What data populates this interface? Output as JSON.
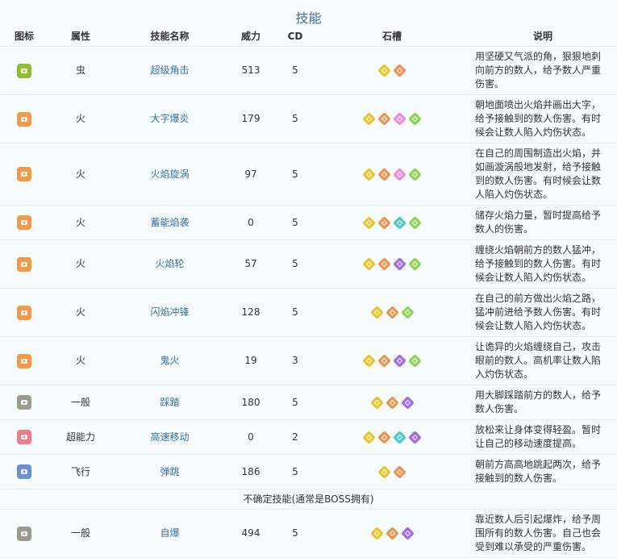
{
  "title": "技能",
  "headers": [
    "图标",
    "属性",
    "技能名称",
    "威力",
    "CD",
    "石槽",
    "说明"
  ],
  "colors": {
    "bug": "#8fbf2f",
    "fire": "#f39a48",
    "normal": "#9a9a8e",
    "psychic": "#ee7b8e",
    "flying": "#6d8fd6",
    "stone_yellow": "#e8c62f",
    "stone_orange": "#ec9552",
    "stone_pink": "#ec8ed6",
    "stone_green": "#8fd45a",
    "stone_teal": "#4fc9c9",
    "stone_purple": "#a36ee0"
  },
  "skills": [
    {
      "icon": "bug-skill-icon",
      "type": "虫",
      "name": "超级角击",
      "power": "513",
      "cd": "5",
      "stones": [
        "yellow",
        "orange"
      ],
      "desc": "用坚硬又气派的角，狠狠地刺向前方的数人，给予数人严重伤害。"
    },
    {
      "icon": "fire-skill-icon",
      "type": "火",
      "name": "大字爆炎",
      "power": "179",
      "cd": "5",
      "stones": [
        "yellow",
        "orange",
        "pink",
        "green"
      ],
      "desc": "朝地面喷出火焰并画出大字，给予接触到的数人伤害。有时候会让数人陷入灼伤状态。"
    },
    {
      "icon": "fire-skill-icon",
      "type": "火",
      "name": "火焰旋涡",
      "power": "97",
      "cd": "5",
      "stones": [
        "yellow",
        "orange",
        "pink",
        "green"
      ],
      "desc": "在自己的周围制造出火焰，并如画漩涡般地发射，给予接触到的数人伤害。有时候会让数人陷入灼伤状态。"
    },
    {
      "icon": "fire-skill-icon",
      "type": "火",
      "name": "蓄能焰袭",
      "power": "0",
      "cd": "5",
      "stones": [
        "yellow",
        "orange",
        "teal",
        "green"
      ],
      "desc": "储存火焰力量，暂时提高给予数人的伤害。"
    },
    {
      "icon": "fire-skill-icon",
      "type": "火",
      "name": "火焰轮",
      "power": "57",
      "cd": "5",
      "stones": [
        "yellow",
        "orange",
        "purple",
        "green"
      ],
      "desc": "缠绕火焰朝前方的数人猛冲，给予接触到的数人伤害。有时候会让数人陷入灼伤状态。"
    },
    {
      "icon": "fire-skill-icon",
      "type": "火",
      "name": "闪焰冲锋",
      "power": "128",
      "cd": "5",
      "stones": [
        "yellow",
        "orange",
        "green"
      ],
      "desc": "在自己的前方做出火焰之路，猛冲前进给予数人伤害。有时候会让数人陷入灼伤状态。"
    },
    {
      "icon": "fire-skill-icon",
      "type": "火",
      "name": "鬼火",
      "power": "19",
      "cd": "3",
      "stones": [
        "yellow",
        "orange",
        "purple",
        "green"
      ],
      "desc": "让诡异的火焰缠绕自己，攻击眼前的数人。高机率让数人陷入灼伤状态。"
    },
    {
      "icon": "normal-skill-icon",
      "type": "一般",
      "name": "踩踏",
      "power": "180",
      "cd": "5",
      "stones": [
        "yellow",
        "orange",
        "purple"
      ],
      "desc": "用大脚踩踏前方的数人，给予数人伤害。"
    },
    {
      "icon": "psychic-skill-icon",
      "type": "超能力",
      "name": "高速移动",
      "power": "0",
      "cd": "2",
      "stones": [
        "yellow",
        "orange",
        "teal",
        "purple"
      ],
      "desc": "放松来让身体变得轻盈。暂时让自己的移动速度提高。"
    },
    {
      "icon": "flying-skill-icon",
      "type": "飞行",
      "name": "弹跳",
      "power": "186",
      "cd": "5",
      "stones": [
        "yellow",
        "orange"
      ],
      "desc": "朝前方高高地跳起两次，给予接触到的数人伤害。"
    }
  ],
  "separator": "不确定技能(通常是BOSS拥有)",
  "boss_skills": [
    {
      "icon": "normal-skill-icon",
      "type": "一般",
      "name": "自爆",
      "power": "494",
      "cd": "5",
      "stones": [
        "yellow",
        "orange",
        "purple"
      ],
      "desc": "靠近数人后引起爆炸，给予周围所有的数人伤害。自己也会受到难以承受的严重伤害。"
    }
  ]
}
